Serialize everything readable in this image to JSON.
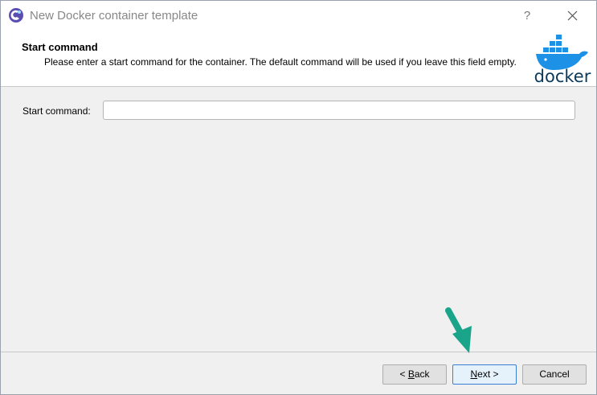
{
  "window": {
    "title": "New Docker container template",
    "help_glyph": "?"
  },
  "banner": {
    "title": "Start command",
    "description": "Please enter a start command for the container. The default command will be used if you leave this field empty.",
    "logo_text": "docker"
  },
  "form": {
    "label": "Start command:",
    "value": "",
    "placeholder": ""
  },
  "buttons": {
    "back_prefix": "< ",
    "back_key": "B",
    "back_rest": "ack",
    "next_key": "N",
    "next_rest": "ext >",
    "cancel": "Cancel"
  },
  "colors": {
    "docker_blue": "#1d91e6",
    "annotation_arrow": "#1aa58a",
    "accent_border": "#3a7fd4"
  },
  "icons": {
    "app": "app-logo-icon",
    "close": "close-icon",
    "help": "help-icon",
    "arrow": "annotation-arrow-icon"
  }
}
